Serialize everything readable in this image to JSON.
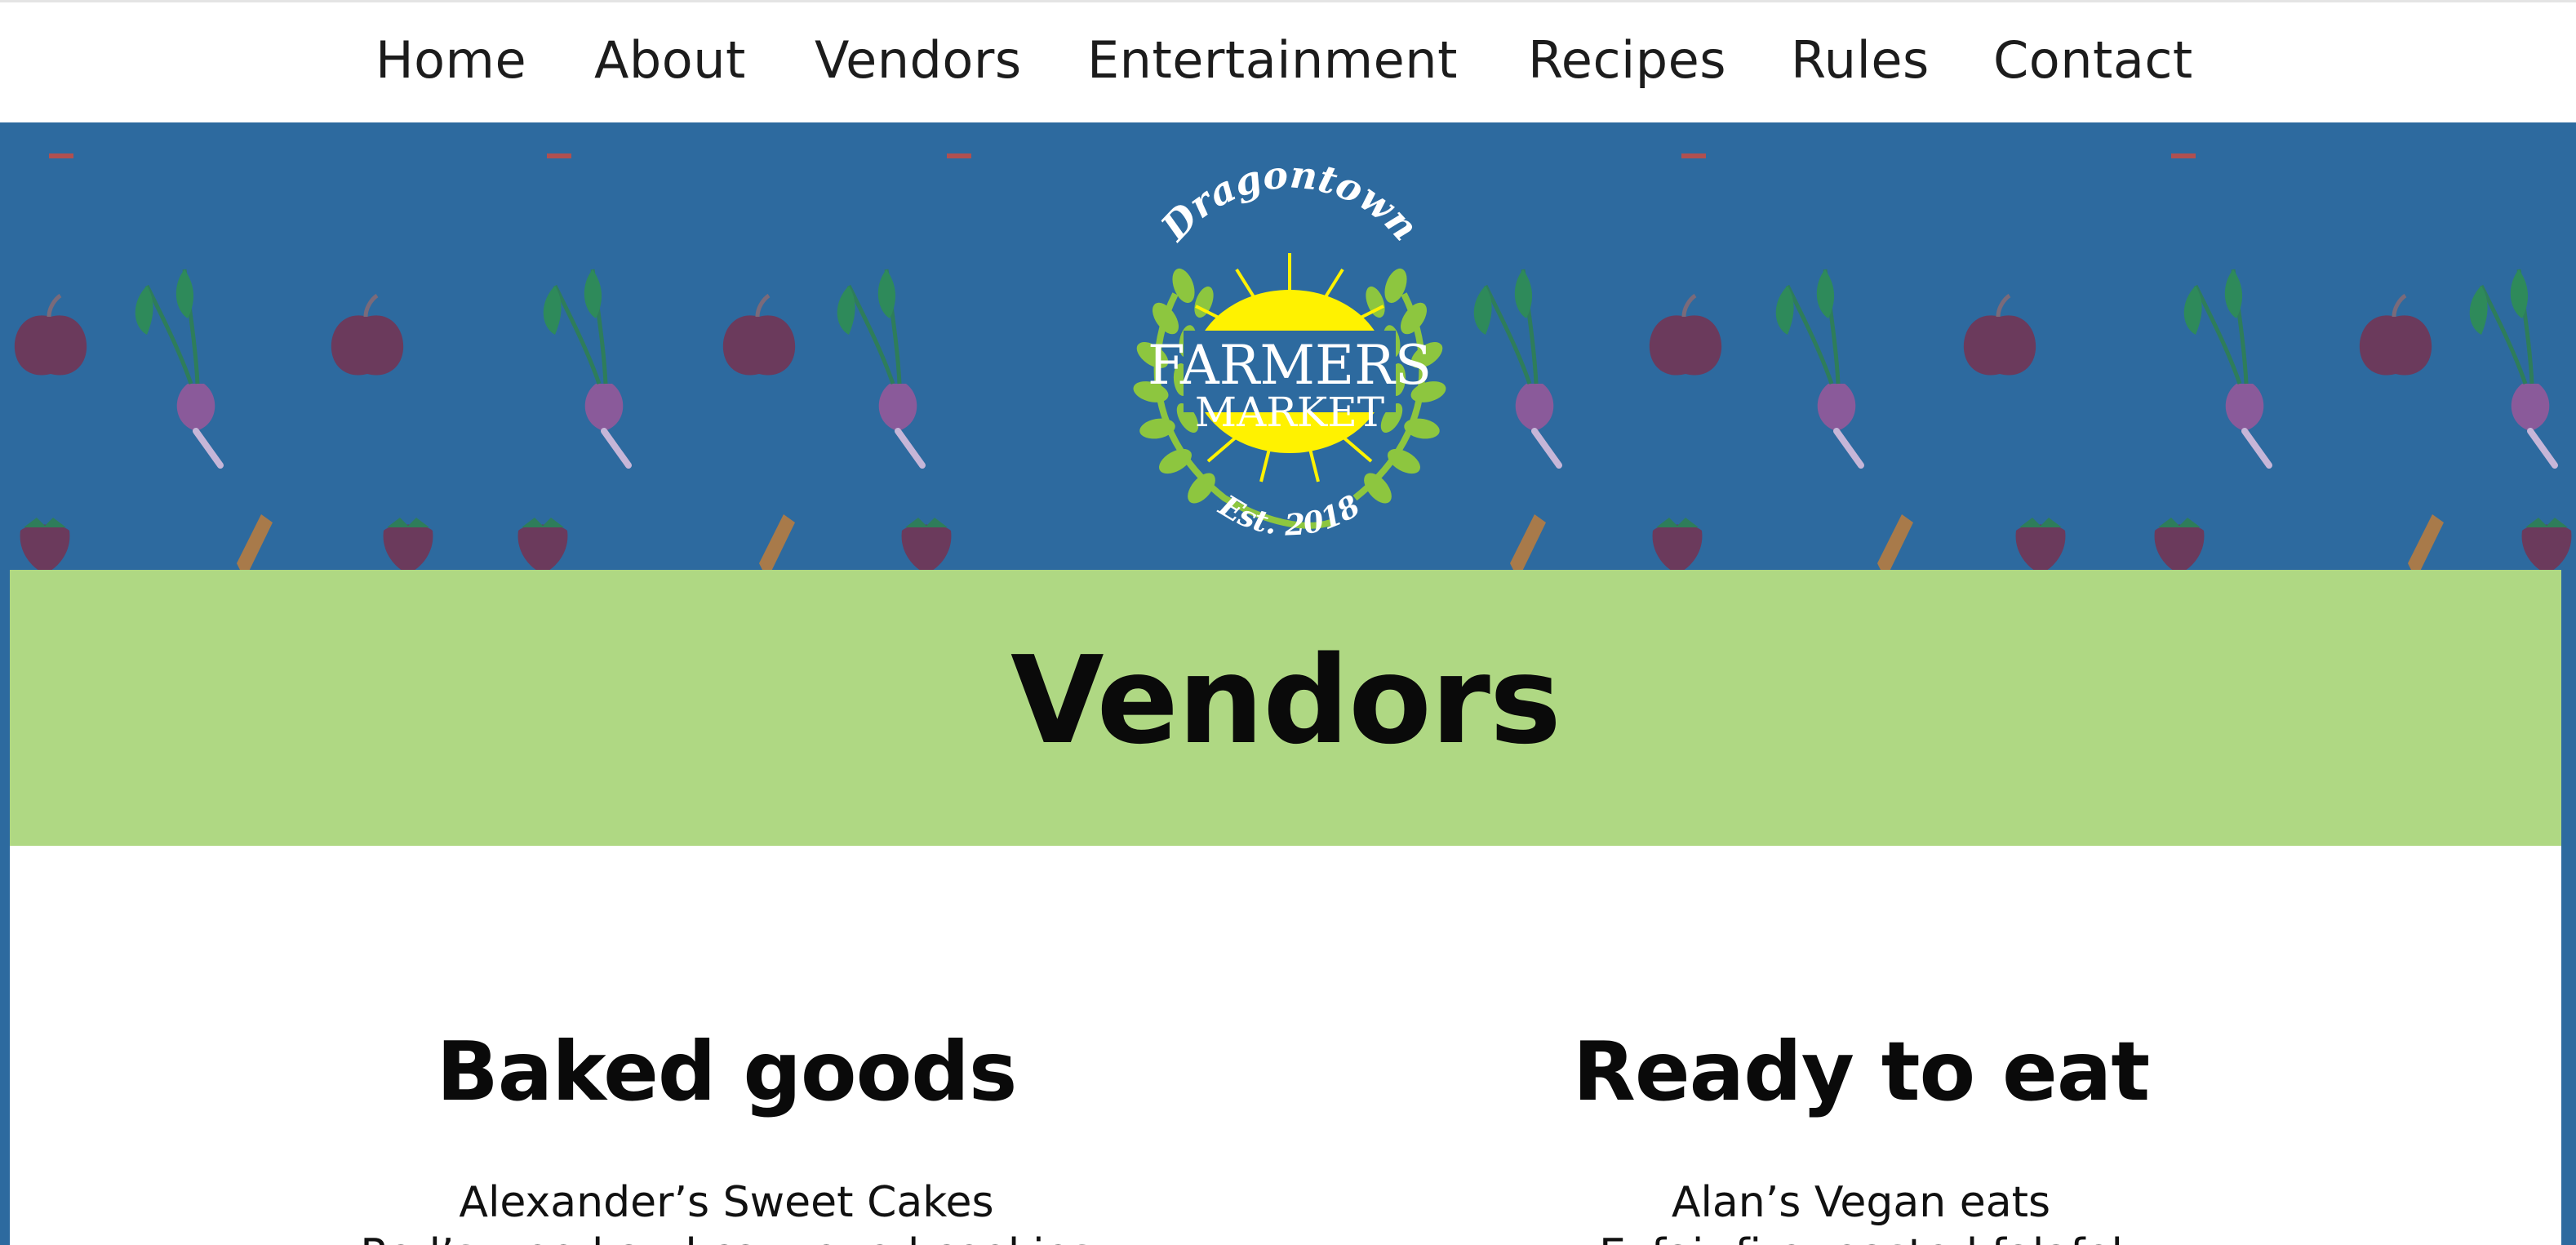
{
  "nav": {
    "items": [
      "Home",
      "About",
      "Vendors",
      "Entertainment",
      "Recipes",
      "Rules",
      "Contact"
    ]
  },
  "logo": {
    "arc_top": "Dragontown",
    "line1": "FARMERS",
    "line2": "MARKET",
    "arc_bottom": "Est. 2018"
  },
  "page": {
    "title": "Vendors"
  },
  "sections": [
    {
      "heading": "Baked goods",
      "vendors": [
        "Alexander’s Sweet Cakes",
        "Rod’s wood and cannoned cookies"
      ]
    },
    {
      "heading": "Ready to eat",
      "vendors": [
        "Alan’s Vegan eats",
        "Exfair fire roasted falafel"
      ]
    }
  ],
  "colors": {
    "hero_bg": "#2d6a9f",
    "title_band": "#afd883",
    "logo_green": "#8dc63f",
    "logo_sun": "#fff200"
  }
}
